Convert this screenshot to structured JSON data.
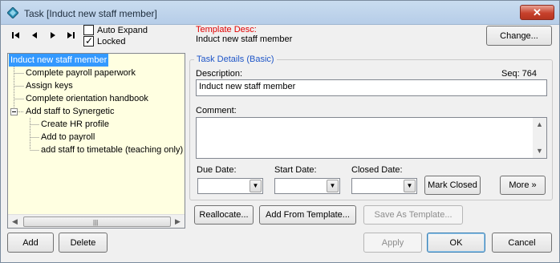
{
  "window": {
    "title": "Task  [Induct new staff member]",
    "close_label": "✕"
  },
  "navigator": {
    "auto_expand_label": "Auto Expand",
    "auto_expand_checked": false,
    "locked_label": "Locked",
    "locked_checked": true
  },
  "tree": {
    "items": [
      {
        "label": "Induct new staff member",
        "level": 0,
        "selected": true
      },
      {
        "label": "Complete payroll paperwork",
        "level": 1
      },
      {
        "label": "Assign keys",
        "level": 1
      },
      {
        "label": "Complete orientation handbook",
        "level": 1
      },
      {
        "label": "Add staff to Synergetic",
        "level": 1,
        "expanded": true
      },
      {
        "label": "Create HR profile",
        "level": 2
      },
      {
        "label": "Add to payroll",
        "level": 2
      },
      {
        "label": "add staff to timetable (teaching only)",
        "level": 2
      }
    ]
  },
  "template": {
    "desc_label": "Template Desc:",
    "desc_value": "Induct new staff member",
    "change_button": "Change..."
  },
  "details": {
    "group_title": "Task Details (Basic)",
    "description_label": "Description:",
    "seq_label": "Seq: 764",
    "description_value": "Induct new staff member",
    "comment_label": "Comment:",
    "comment_value": "",
    "due_date_label": "Due Date:",
    "start_date_label": "Start Date:",
    "closed_date_label": "Closed Date:",
    "mark_closed_button": "Mark Closed",
    "more_button": "More »"
  },
  "actions": {
    "reallocate_button": "Reallocate...",
    "add_from_template_button": "Add From Template...",
    "save_as_template_button": "Save As Template..."
  },
  "footer": {
    "add_button": "Add",
    "delete_button": "Delete",
    "apply_button": "Apply",
    "ok_button": "OK",
    "cancel_button": "Cancel"
  },
  "colors": {
    "tree_background": "#ffffe1",
    "selection": "#3399ff",
    "template_label": "#e00000",
    "group_title": "#1f56c8"
  }
}
